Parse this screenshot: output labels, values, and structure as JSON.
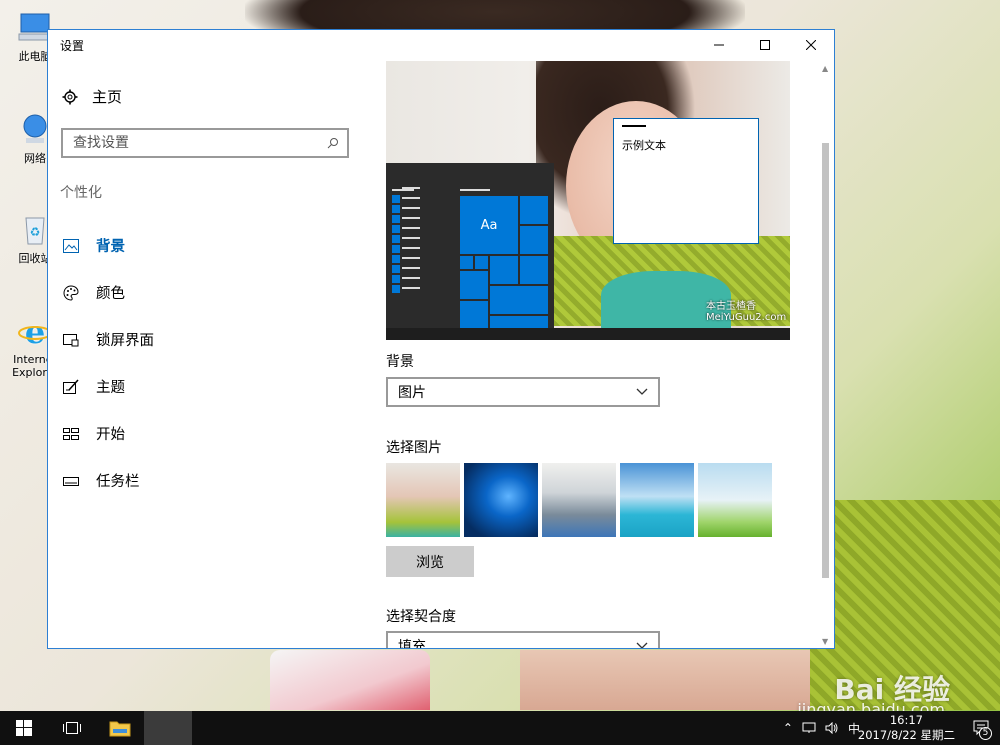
{
  "desktop": {
    "icons": [
      {
        "name": "this-pc",
        "label": "此电脑"
      },
      {
        "name": "network",
        "label": "网络"
      },
      {
        "name": "recycle-bin",
        "label": "回收站"
      },
      {
        "name": "ie",
        "label": "Internet Explorer"
      }
    ],
    "watermark": "Bai 经验",
    "watermark_sub": "jingyan.baidu.com"
  },
  "window": {
    "title": "设置",
    "home_label": "主页",
    "search_placeholder": "查找设置",
    "section_label": "个性化",
    "nav": [
      {
        "label": "背景",
        "icon": "picture-icon",
        "active": true
      },
      {
        "label": "颜色",
        "icon": "palette-icon",
        "active": false
      },
      {
        "label": "锁屏界面",
        "icon": "lock-screen-icon",
        "active": false
      },
      {
        "label": "主题",
        "icon": "theme-icon",
        "active": false
      },
      {
        "label": "开始",
        "icon": "start-icon",
        "active": false
      },
      {
        "label": "任务栏",
        "icon": "taskbar-icon",
        "active": false
      }
    ]
  },
  "content": {
    "preview": {
      "sample_text": "示例文本",
      "tile_text": "Aa",
      "logo": "本古玉楂香 MeiYuGuu2.com"
    },
    "background_label": "背景",
    "background_value": "图片",
    "choose_picture_label": "选择图片",
    "browse_label": "浏览",
    "fit_label": "选择契合度",
    "fit_value": "填充"
  },
  "taskbar": {
    "time": "16:17",
    "date": "2017/8/22 星期二",
    "ime": "中",
    "notification_count": "5",
    "accent": "#0078d7"
  }
}
